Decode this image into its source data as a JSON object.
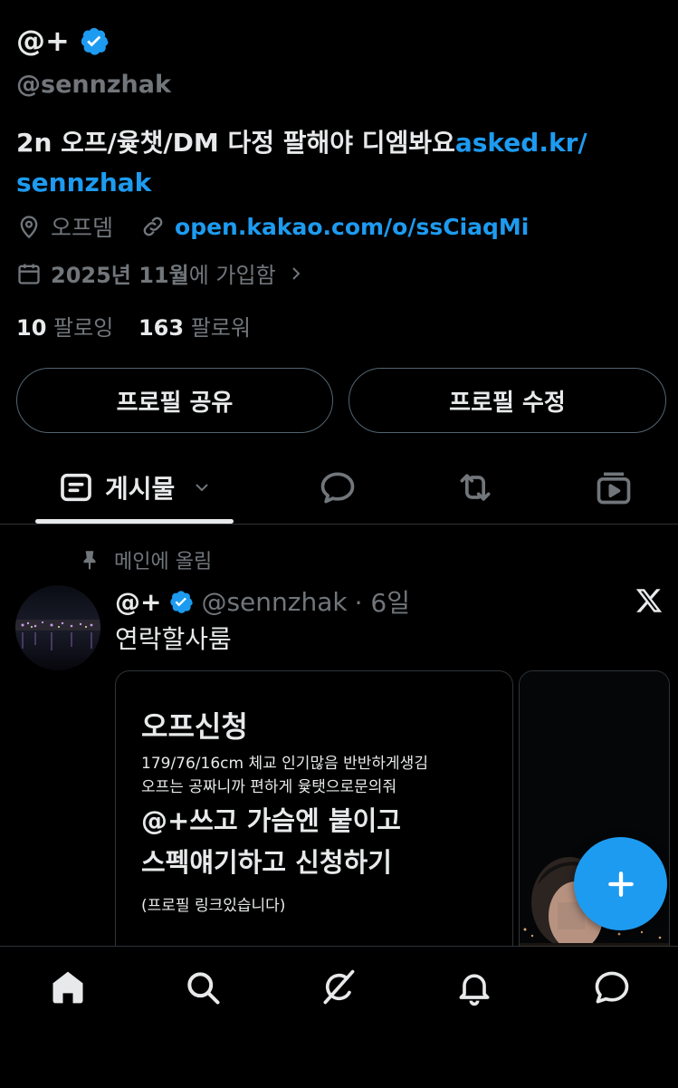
{
  "profile": {
    "name": "@+",
    "handle": "@sennzhak",
    "bio_text": "2n 오프/윷챗/DM 다정 팔해야 디엠봐요",
    "bio_link_1": "asked.kr/",
    "bio_link_2": "sennzhak",
    "location": "오프뎀",
    "website": "open.kakao.com/o/ssCiaqMi",
    "join_year": "2025년 11월",
    "join_suffix": "에 가입함",
    "following_count": "10",
    "following_label": "팔로잉",
    "followers_count": "163",
    "followers_label": "팔로워"
  },
  "buttons": {
    "share_profile": "프로필 공유",
    "edit_profile": "프로필 수정"
  },
  "tabs": {
    "posts_label": "게시물"
  },
  "pinned_post": {
    "pinned_label": "메인에 올림",
    "author_name": "@+",
    "author_handle": "@sennzhak",
    "time": "· 6일",
    "text": "연락할사룸",
    "card_title": "오프신청",
    "card_line1": "179/76/16cm 체교 인기많음 반반하게생김",
    "card_line2": "오프는 공짜니까 편하게 윷탯으로문의줘",
    "card_line3": "@+쓰고 가슴엔 붙이고",
    "card_line4": "스펙얘기하고 신청하기",
    "card_line5": "(프로필 링크있습니다)"
  },
  "colors": {
    "accent": "#1d9bf0",
    "background": "#000000",
    "text_primary": "#e7e9ea",
    "text_secondary": "#71767b",
    "border": "#2f3336"
  },
  "icons": [
    "verified-icon",
    "location-icon",
    "link-icon",
    "calendar-icon",
    "chevron-right-icon",
    "posts-icon",
    "chevron-down-icon",
    "replies-icon",
    "reposts-icon",
    "media-icon",
    "pin-icon",
    "x-logo-icon",
    "plus-icon",
    "home-icon",
    "search-icon",
    "grok-icon",
    "notifications-icon",
    "messages-icon"
  ]
}
